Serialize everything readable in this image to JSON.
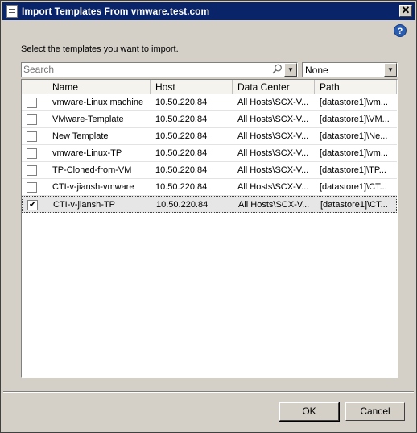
{
  "window": {
    "title": "Import Templates From vmware.test.com"
  },
  "instruction": "Select the templates you want to import.",
  "search": {
    "placeholder": "Search",
    "value": ""
  },
  "filter": {
    "selected": "None"
  },
  "columns": {
    "name": "Name",
    "host": "Host",
    "datacenter": "Data Center",
    "path": "Path"
  },
  "rows": [
    {
      "checked": false,
      "name": "vmware-Linux machine",
      "host": "10.50.220.84",
      "datacenter": "All Hosts\\SCX-V...",
      "path": "[datastore1]\\vm..."
    },
    {
      "checked": false,
      "name": "VMware-Template",
      "host": "10.50.220.84",
      "datacenter": "All Hosts\\SCX-V...",
      "path": "[datastore1]\\VM..."
    },
    {
      "checked": false,
      "name": "New Template",
      "host": "10.50.220.84",
      "datacenter": "All Hosts\\SCX-V...",
      "path": "[datastore1]\\Ne..."
    },
    {
      "checked": false,
      "name": "vmware-Linux-TP",
      "host": "10.50.220.84",
      "datacenter": "All Hosts\\SCX-V...",
      "path": "[datastore1]\\vm..."
    },
    {
      "checked": false,
      "name": "TP-Cloned-from-VM",
      "host": "10.50.220.84",
      "datacenter": "All Hosts\\SCX-V...",
      "path": "[datastore1]\\TP..."
    },
    {
      "checked": false,
      "name": "CTI-v-jiansh-vmware",
      "host": "10.50.220.84",
      "datacenter": "All Hosts\\SCX-V...",
      "path": "[datastore1]\\CT..."
    },
    {
      "checked": true,
      "name": "CTI-v-jiansh-TP",
      "host": "10.50.220.84",
      "datacenter": "All Hosts\\SCX-V...",
      "path": "[datastore1]\\CT..."
    }
  ],
  "buttons": {
    "ok": "OK",
    "cancel": "Cancel"
  },
  "icons": {
    "close": "close-icon",
    "help": "help-icon",
    "search": "search-icon",
    "dropdown": "chevron-down-icon",
    "window": "window-icon"
  },
  "colors": {
    "titlebar": "#0a246a",
    "help": "#2a5db0",
    "selected_row": "#e6e6e6"
  }
}
